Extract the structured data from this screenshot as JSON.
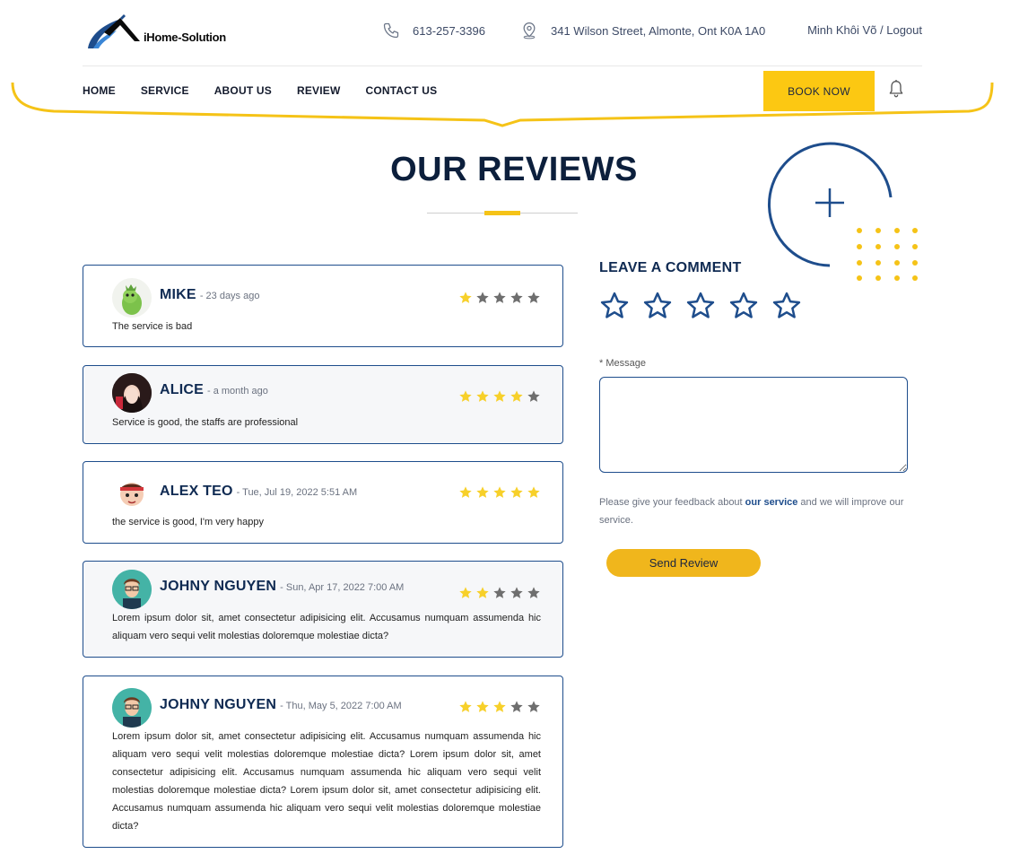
{
  "header": {
    "logo_text": "iHome-Solution",
    "phone": "613-257-3396",
    "address": "341 Wilson Street, Almonte, Ont K0A 1A0",
    "user_name": "Minh Khôi Võ",
    "separator": " / ",
    "logout_label": "Logout"
  },
  "nav": {
    "items": [
      "HOME",
      "SERVICE",
      "ABOUT US",
      "REVIEW",
      "CONTACT US"
    ],
    "book_label": "BOOK NOW"
  },
  "page": {
    "title": "OUR REVIEWS"
  },
  "reviews": [
    {
      "name": "MIKE",
      "time": "- 23 days ago",
      "rating": 1,
      "text": "The service is bad"
    },
    {
      "name": "ALICE",
      "time": "- a month ago",
      "rating": 4,
      "text": "Service is good, the staffs are professional"
    },
    {
      "name": "ALEX TEO",
      "time": "- Tue, Jul 19, 2022 5:51 AM",
      "rating": 5,
      "text": "the service is good, I'm very happy"
    },
    {
      "name": "JOHNY NGUYEN",
      "time": "- Sun, Apr 17, 2022 7:00 AM",
      "rating": 2,
      "text": "Lorem ipsum dolor sit, amet consectetur adipisicing elit. Accusamus numquam assumenda hic aliquam vero sequi velit molestias doloremque molestiae dicta?"
    },
    {
      "name": "JOHNY NGUYEN",
      "time": "- Thu, May 5, 2022 7:00 AM",
      "rating": 3,
      "text": "Lorem ipsum dolor sit, amet consectetur adipisicing elit. Accusamus numquam assumenda hic aliquam vero sequi velit molestias doloremque molestiae dicta? Lorem ipsum dolor sit, amet consectetur adipisicing elit. Accusamus numquam assumenda hic aliquam vero sequi velit molestias doloremque molestiae dicta? Lorem ipsum dolor sit, amet consectetur adipisicing elit. Accusamus numquam assumenda hic aliquam vero sequi velit molestias doloremque molestiae dicta?"
    }
  ],
  "form": {
    "title": "LEAVE A COMMENT",
    "message_label": "* Message",
    "message_value": "",
    "hint_before": "Please give your feedback about ",
    "hint_bold": "our service",
    "hint_after": " and we will improve our service.",
    "send_label": "Send Review",
    "selected_rating": 0
  },
  "colors": {
    "accent_yellow": "#fcc812",
    "navy": "#0f2a52",
    "border_blue": "#1e4d8c",
    "star_gray": "#6e6e6e"
  },
  "icons": {
    "phone": "phone-icon",
    "address": "map-pin-icon",
    "bell": "bell-icon",
    "star": "star-icon",
    "plus": "plus-icon"
  }
}
